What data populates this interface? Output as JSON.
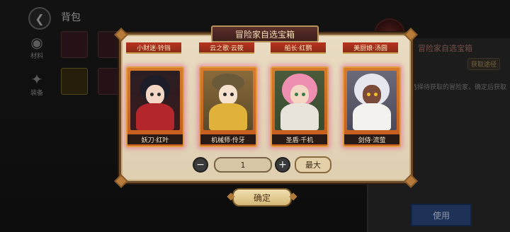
{
  "header": {
    "title": "背包"
  },
  "sidebar": {
    "items": [
      {
        "label": "材料"
      },
      {
        "label": "装备"
      }
    ]
  },
  "right_panel": {
    "title": "冒险家自选宝箱",
    "chip": "获取途径",
    "desc": "选择待获取的冒险家，确定后获取",
    "use_label": "使用"
  },
  "modal": {
    "title": "冒险家自选宝箱",
    "top_row": [
      "小财迷·铃铛",
      "云之歌·云筱",
      "船长·红鹦",
      "美厨娘·汤圆"
    ],
    "cards": [
      {
        "name": "妖刀·红叶"
      },
      {
        "name": "机械师·伶牙"
      },
      {
        "name": "圣盾·千机"
      },
      {
        "name": "剑侍·流萤"
      }
    ],
    "quantity": {
      "value": "1",
      "minus": "−",
      "plus": "+",
      "max_label": "最大"
    },
    "confirm_label": "确定"
  }
}
